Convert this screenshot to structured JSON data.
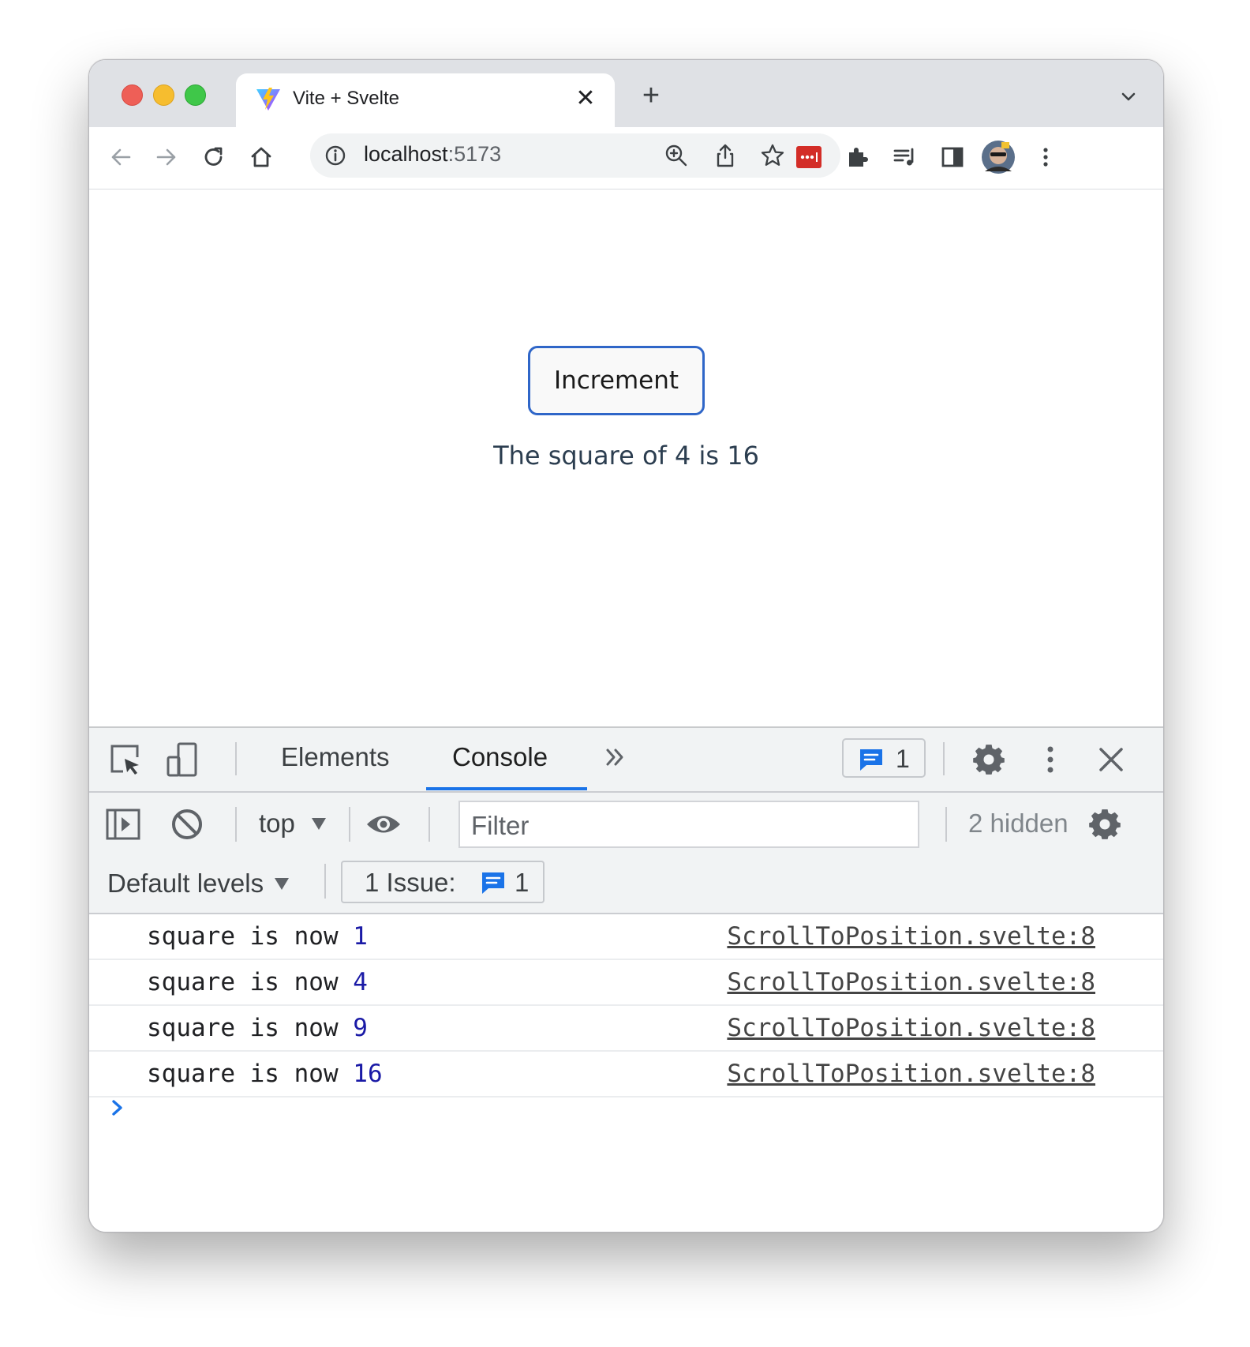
{
  "browser": {
    "tab_title": "Vite + Svelte",
    "url_host": "localhost",
    "url_port": ":5173"
  },
  "page": {
    "button_label": "Increment",
    "result_text": "The square of 4 is 16"
  },
  "devtools": {
    "tabs": [
      "Elements",
      "Console"
    ],
    "active_tab": "Console",
    "issues_badge_count": "1",
    "context": "top",
    "filter_placeholder": "Filter",
    "hidden_count": "2 hidden",
    "levels": "Default levels",
    "issues_label": "1 Issue:",
    "issues_count": "1",
    "logs": [
      {
        "message": "square is now ",
        "value": "1",
        "source": "ScrollToPosition.svelte:8"
      },
      {
        "message": "square is now ",
        "value": "4",
        "source": "ScrollToPosition.svelte:8"
      },
      {
        "message": "square is now ",
        "value": "9",
        "source": "ScrollToPosition.svelte:8"
      },
      {
        "message": "square is now ",
        "value": "16",
        "source": "ScrollToPosition.svelte:8"
      }
    ]
  },
  "colors": {
    "accent": "#1a73e8",
    "button_border": "#2f66c8",
    "log_number": "#1a1aa6"
  }
}
